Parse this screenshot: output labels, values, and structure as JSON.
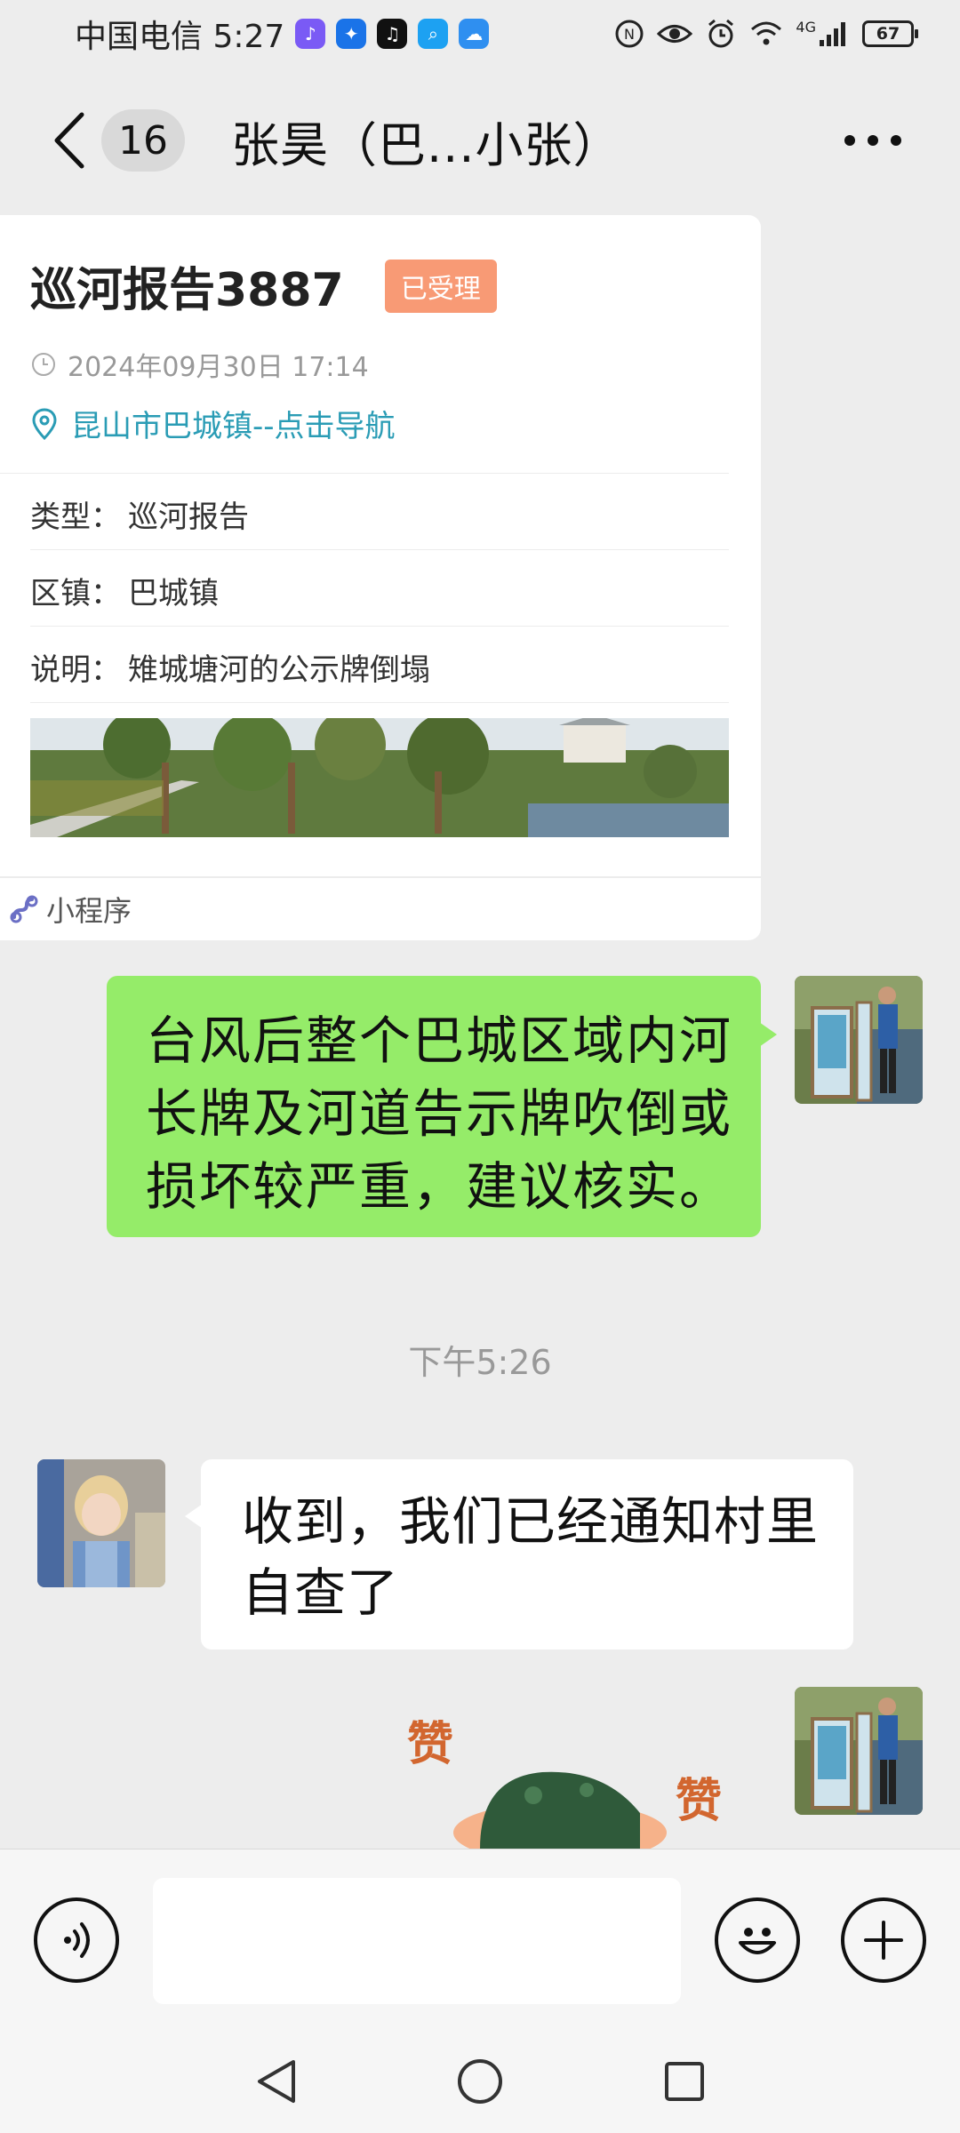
{
  "status_bar": {
    "carrier_time": "中国电信 5:27",
    "network_type": "4G",
    "battery": "67"
  },
  "header": {
    "unread_count": "16",
    "title": "张昊（巴...小张）"
  },
  "mini_program_card": {
    "title": "巡河报告3887",
    "status": "已受理",
    "datetime": "2024年09月30日 17:14",
    "location": "昆山市巴城镇--点击导航",
    "rows": [
      {
        "label": "类型：",
        "value": "巡河报告"
      },
      {
        "label": "区镇：",
        "value": "巴城镇"
      },
      {
        "label": "说明：",
        "value": "雉城塘河的公示牌倒塌"
      }
    ],
    "footer_label": "小程序"
  },
  "messages": {
    "outgoing_1": {
      "lines": [
        "台风后整个巴城区域内河",
        "长牌及河道告示牌吹倒或",
        "损坏较严重，建议核实。"
      ]
    },
    "timestamp": "下午5:26",
    "incoming_1": {
      "lines": [
        "收到，我们已经通知村里",
        "自查了"
      ]
    },
    "sticker_text_1": "赞",
    "sticker_text_2": "赞"
  },
  "colors": {
    "outgoing_bubble": "#95ec69",
    "status_badge": "#f89a75",
    "link": "#2a9cb5",
    "background": "#ededed"
  },
  "icons": {
    "voice": "voice-icon",
    "emoji": "emoji-icon",
    "plus": "plus-icon",
    "back": "chevron-left-icon",
    "more": "more-dots-icon"
  }
}
